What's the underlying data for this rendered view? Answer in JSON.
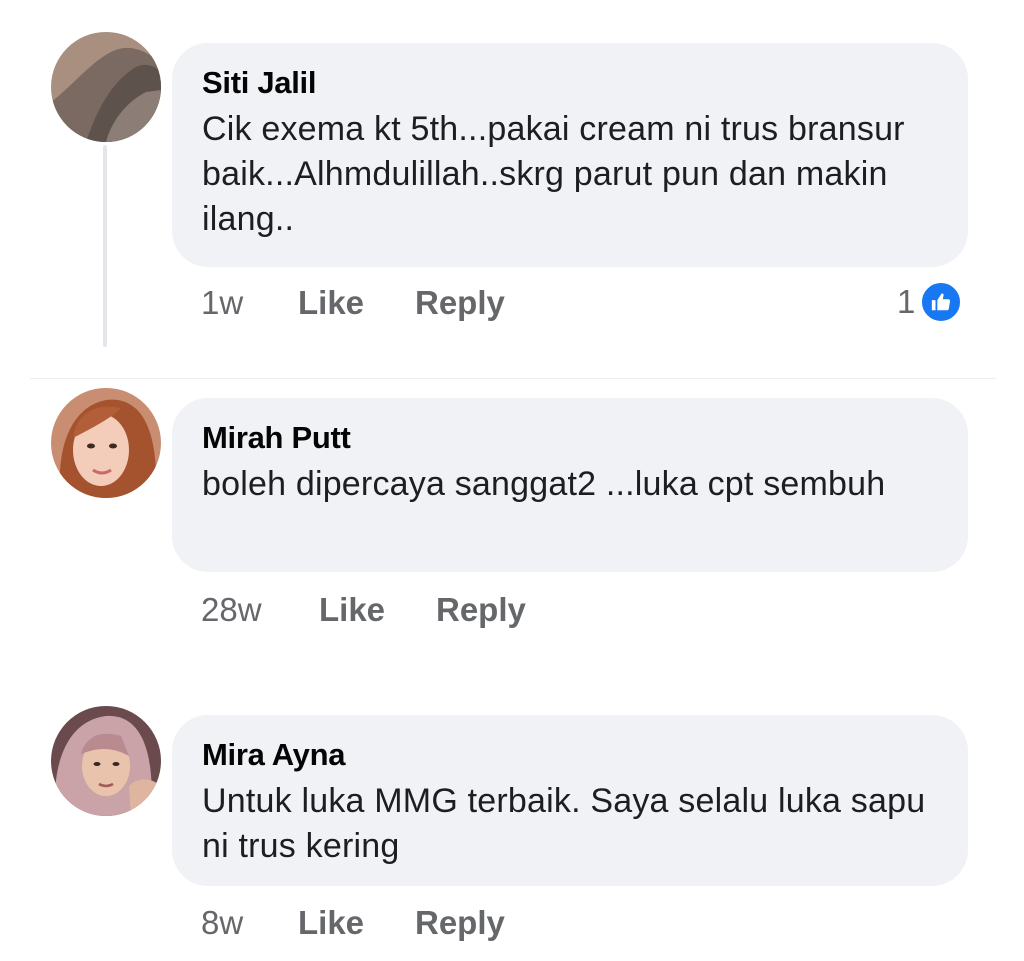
{
  "comments": [
    {
      "author": "Siti Jalil",
      "text": "Cik exema kt 5th...pakai cream ni trus bransur baik...Alhmdulillah..skrg parut pun dan makin ilang..",
      "time": "1w",
      "like_label": "Like",
      "reply_label": "Reply",
      "reaction_count": "1",
      "reaction_icon": "like-icon"
    },
    {
      "author": "Mirah Putt",
      "text": "boleh dipercaya sanggat2 ...luka cpt sembuh",
      "time": "28w",
      "like_label": "Like",
      "reply_label": "Reply"
    },
    {
      "author": "Mira Ayna",
      "text": "Untuk luka MMG terbaik. Saya selalu luka sapu ni trus kering",
      "time": "8w",
      "like_label": "Like",
      "reply_label": "Reply"
    }
  ],
  "colors": {
    "bubble_bg": "#f0f2f5",
    "secondary_text": "#65676b",
    "like_blue": "#1877f2"
  }
}
